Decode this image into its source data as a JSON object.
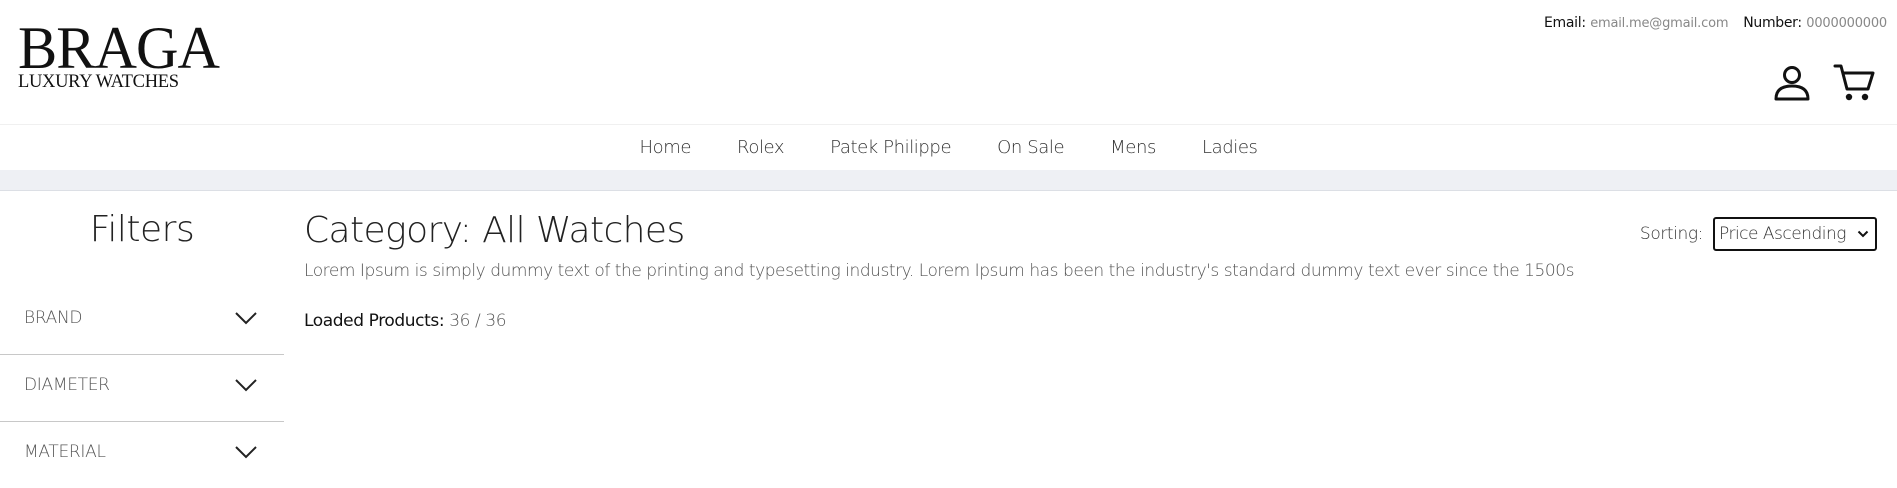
{
  "header": {
    "logo": {
      "title": "BRAGA",
      "subtitle": "LUXURY WATCHES"
    },
    "contact": {
      "email_label": "Email:",
      "email_value": "email.me@gmail.com",
      "number_label": "Number:",
      "number_value": "0000000000"
    },
    "icons": {
      "account": "user-icon",
      "cart": "cart-icon"
    }
  },
  "nav": {
    "items": [
      {
        "label": "Home"
      },
      {
        "label": "Rolex"
      },
      {
        "label": "Patek Philippe"
      },
      {
        "label": "On Sale"
      },
      {
        "label": "Mens"
      },
      {
        "label": "Ladies"
      }
    ]
  },
  "sidebar": {
    "title": "Filters",
    "filters": [
      {
        "label": "BRAND",
        "icon": "chevron-down-icon"
      },
      {
        "label": "DIAMETER",
        "icon": "chevron-down-icon"
      },
      {
        "label": "MATERIAL",
        "icon": "chevron-down-icon"
      }
    ]
  },
  "main": {
    "title": "Category: All Watches",
    "description": "Lorem Ipsum is simply dummy text of the printing and typesetting industry. Lorem Ipsum has been the industry's standard dummy text ever since the 1500s",
    "loaded_label": "Loaded Products:",
    "loaded_value": "36 / 36",
    "sorting": {
      "label": "Sorting:",
      "selected": "Price Ascending"
    }
  },
  "colors": {
    "strip": "#eef0f4",
    "text": "#222222",
    "muted": "#555555",
    "border": "#c8c8c8"
  }
}
